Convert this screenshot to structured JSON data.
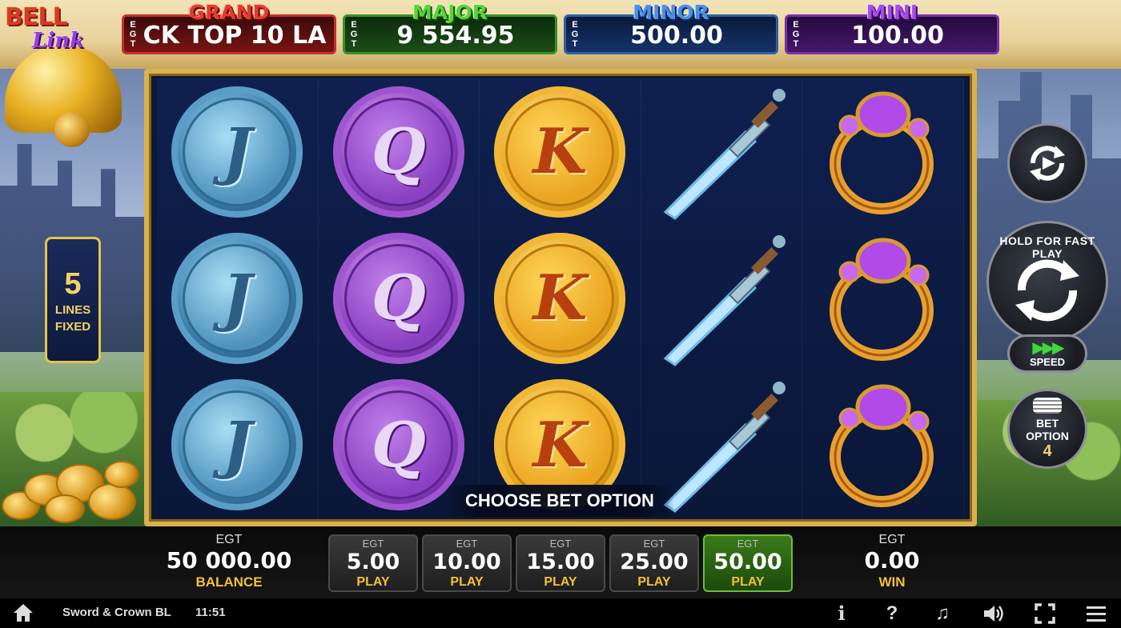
{
  "game": {
    "title": "Sword & Crown BL",
    "clock": "11:51",
    "logo_top": "BELL",
    "logo_bottom": "Link"
  },
  "jackpots": [
    {
      "label": "GRAND",
      "currency": "EGT",
      "value": "CK   TOP 10   LA",
      "color": "#e83a2a"
    },
    {
      "label": "MAJOR",
      "currency": "EGT",
      "value": "9 554.95",
      "color": "#5ad23a"
    },
    {
      "label": "MINOR",
      "currency": "EGT",
      "value": "500.00",
      "color": "#4a8fe8"
    },
    {
      "label": "MINI",
      "currency": "EGT",
      "value": "100.00",
      "color": "#a64ae8"
    }
  ],
  "reels": [
    [
      "J",
      "J",
      "J"
    ],
    [
      "Q",
      "Q",
      "Q"
    ],
    [
      "K",
      "K",
      "K"
    ],
    [
      "sword",
      "sword",
      "sword"
    ],
    [
      "ring",
      "ring",
      "ring"
    ]
  ],
  "lines": {
    "count": "5",
    "line1": "LINES",
    "line2": "FIXED"
  },
  "prompt": "CHOOSE BET OPTION",
  "controls": {
    "hold_text": "HOLD FOR FAST PLAY",
    "speed_label": "SPEED",
    "bet_option_line1": "BET",
    "bet_option_line2": "OPTION",
    "bet_option_value": "4"
  },
  "balance": {
    "currency": "EGT",
    "value": "50 000.00",
    "label": "BALANCE"
  },
  "win": {
    "currency": "EGT",
    "value": "0.00",
    "label": "WIN"
  },
  "bets": [
    {
      "currency": "EGT",
      "amount": "5.00",
      "label": "PLAY",
      "active": false
    },
    {
      "currency": "EGT",
      "amount": "10.00",
      "label": "PLAY",
      "active": false
    },
    {
      "currency": "EGT",
      "amount": "15.00",
      "label": "PLAY",
      "active": false
    },
    {
      "currency": "EGT",
      "amount": "25.00",
      "label": "PLAY",
      "active": false
    },
    {
      "currency": "EGT",
      "amount": "50.00",
      "label": "PLAY",
      "active": true
    }
  ],
  "statusbar_icons": [
    "info-icon",
    "help-icon",
    "music-icon",
    "volume-icon",
    "fullscreen-icon",
    "menu-icon"
  ]
}
